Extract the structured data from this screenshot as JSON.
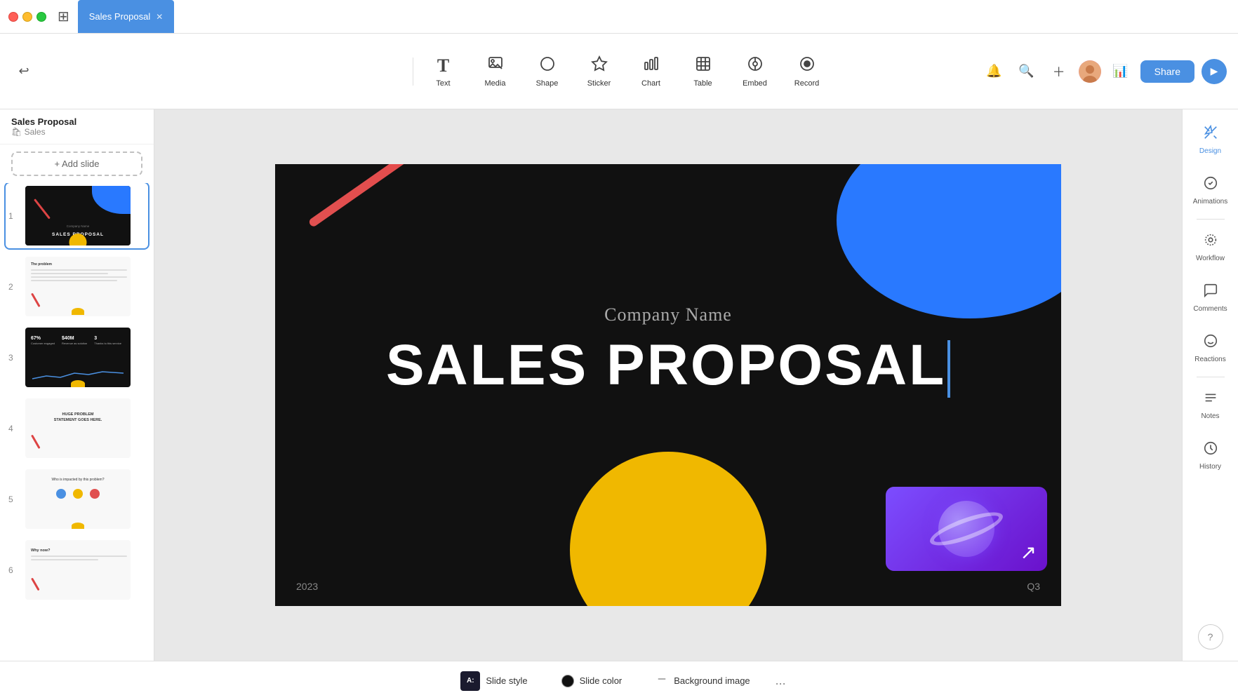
{
  "titleBar": {
    "appTitle": "Sales Proposal",
    "tabClose": "✕"
  },
  "toolbar": {
    "undoLabel": "↩",
    "tools": [
      {
        "id": "text",
        "label": "Text",
        "icon": "T"
      },
      {
        "id": "media",
        "label": "Media",
        "icon": "▦"
      },
      {
        "id": "shape",
        "label": "Shape",
        "icon": "◎"
      },
      {
        "id": "sticker",
        "label": "Sticker",
        "icon": "★"
      },
      {
        "id": "chart",
        "label": "Chart",
        "icon": "📊"
      },
      {
        "id": "table",
        "label": "Table",
        "icon": "⊞"
      },
      {
        "id": "embed",
        "label": "Embed",
        "icon": "⊕"
      },
      {
        "id": "record",
        "label": "Record",
        "icon": "⏺"
      }
    ],
    "shareLabel": "Share"
  },
  "breadcrumb": {
    "title": "Sales Proposal",
    "subtitle": "🛍 Sales"
  },
  "addSlide": "+ Add slide",
  "slides": [
    {
      "number": "1",
      "id": "slide-1",
      "active": true
    },
    {
      "number": "2",
      "id": "slide-2",
      "active": false
    },
    {
      "number": "3",
      "id": "slide-3",
      "active": false
    },
    {
      "number": "4",
      "id": "slide-4",
      "active": false
    },
    {
      "number": "5",
      "id": "slide-5",
      "active": false
    },
    {
      "number": "6",
      "id": "slide-6",
      "active": false
    }
  ],
  "slide": {
    "companyName": "Company Name",
    "mainTitle": "SALES PROPOSAL",
    "year": "2023",
    "quarter": "Q3"
  },
  "rightPanel": {
    "tools": [
      {
        "id": "design",
        "label": "Design",
        "icon": "✂"
      },
      {
        "id": "animations",
        "label": "Animations",
        "icon": "⟳"
      },
      {
        "id": "workflow",
        "label": "Workflow",
        "icon": "⊙"
      },
      {
        "id": "comments",
        "label": "Comments",
        "icon": "💬"
      },
      {
        "id": "reactions",
        "label": "Reactions",
        "icon": "😊"
      },
      {
        "id": "notes",
        "label": "Notes",
        "icon": "☰"
      },
      {
        "id": "history",
        "label": "History",
        "icon": "🕐"
      }
    ],
    "helpLabel": "?"
  },
  "bottomBar": {
    "slideStyleLabel": "Slide style",
    "slideColorLabel": "Slide color",
    "backgroundImageLabel": "Background image",
    "moreLabel": "..."
  }
}
